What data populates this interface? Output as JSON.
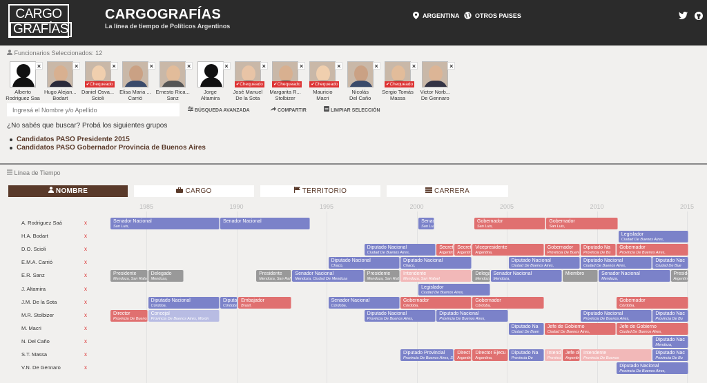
{
  "header": {
    "logo_line1": "CARGO",
    "logo_line2": "GRAFÍAS",
    "title": "CARGOGRAFÍAS",
    "subtitle": "La línea de tiempo de Políticos Argentinos",
    "nav": [
      {
        "label": "ARGENTINA",
        "icon": "map-pin-icon"
      },
      {
        "label": "OTROS PAISES",
        "icon": "globe-icon"
      }
    ],
    "social": [
      {
        "icon": "twitter-icon"
      },
      {
        "icon": "github-icon"
      }
    ]
  },
  "selection": {
    "heading": "Funcionarios Seleccionados: 12",
    "check_label": "Chequeado",
    "people": [
      {
        "name1": "Alberto",
        "name2": "Rodriguez Saa",
        "photo": "silhouette",
        "checked": false
      },
      {
        "name1": "Hugo Alejan...",
        "name2": "Bodart",
        "photo": "photo",
        "checked": false
      },
      {
        "name1": "Daniel Osva...",
        "name2": "Scioli",
        "photo": "photo",
        "checked": true
      },
      {
        "name1": "Elisa Maria ...",
        "name2": "Carrió",
        "photo": "photo",
        "checked": false
      },
      {
        "name1": "Ernesto Rica...",
        "name2": "Sanz",
        "photo": "photo",
        "checked": false
      },
      {
        "name1": "Jorge",
        "name2": "Altamira",
        "photo": "silhouette",
        "checked": false
      },
      {
        "name1": "José Manuel",
        "name2": "De la Sota",
        "photo": "photo",
        "checked": true
      },
      {
        "name1": "Margarita R...",
        "name2": "Stolbizer",
        "photo": "photo",
        "checked": true
      },
      {
        "name1": "Mauricio",
        "name2": "Macri",
        "photo": "photo",
        "checked": true
      },
      {
        "name1": "Nicolás",
        "name2": "Del Caño",
        "photo": "photo",
        "checked": false
      },
      {
        "name1": "Sergio Tomás",
        "name2": "Massa",
        "photo": "photo",
        "checked": true
      },
      {
        "name1": "Victor Norb...",
        "name2": "De Gennaro",
        "photo": "photo",
        "checked": false
      }
    ],
    "search_placeholder": "Ingresá el Nombre y/o Apellido",
    "actions": [
      {
        "label": "BÚSQUEDA AVANZADA",
        "icon": "sliders-icon"
      },
      {
        "label": "COMPARTIR",
        "icon": "share-icon"
      },
      {
        "label": "LIMPIAR SELECCIÓN",
        "icon": "minus-icon"
      }
    ],
    "hint": "¿No sabés que buscar? Probá los siguientes grupos",
    "groups": [
      "Candidatos PASO Presidente 2015",
      "Candidatos PASO Gobernador Provincia de Buenos Aires"
    ]
  },
  "timeline": {
    "heading": "Línea de Tiempo",
    "tabs": [
      {
        "label": "NOMBRE",
        "icon": "user-icon",
        "active": true
      },
      {
        "label": "CARGO",
        "icon": "briefcase-icon",
        "active": false
      },
      {
        "label": "TERRITORIO",
        "icon": "flag-icon",
        "active": false
      },
      {
        "label": "CARRERA",
        "icon": "list-icon",
        "active": false
      }
    ],
    "years": [
      "1985",
      "1990",
      "1995",
      "2000",
      "2005",
      "2010",
      "2015"
    ],
    "remove_mark": "x",
    "colors": {
      "blue": "#7b82c9",
      "red": "#e07070",
      "gray": "#999999",
      "pink": "#f2b8b8",
      "lavender": "#b8bce3"
    },
    "rows": [
      {
        "label": "A. Rodriguez Saá",
        "bars": [
          {
            "t": "Senador Nacional",
            "s": "San Luis,",
            "from": 1983.0,
            "to": 1989.1,
            "c": "blue"
          },
          {
            "t": "Senador Nacional",
            "s": "",
            "from": 1989.1,
            "to": 1994.1,
            "c": "blue"
          },
          {
            "t": "Senad",
            "s": "San Luis,",
            "from": 2000.1,
            "to": 2001.0,
            "c": "blue"
          },
          {
            "t": "Gobernador",
            "s": "San Luis,",
            "from": 2003.2,
            "to": 2007.2,
            "c": "red"
          },
          {
            "t": "Gobernador",
            "s": "San Luis,",
            "from": 2007.2,
            "to": 2011.2,
            "c": "red"
          }
        ]
      },
      {
        "label": "H.A. Bodart",
        "bars": [
          {
            "t": "Legislador",
            "s": "Ciudad De Buenos Aires,",
            "from": 2011.2,
            "to": 2015.1,
            "c": "blue"
          }
        ]
      },
      {
        "label": "D.O. Scioli",
        "bars": [
          {
            "t": "Diputado Nacional",
            "s": "Ciudad De Buenos Aires,",
            "from": 1997.1,
            "to": 2001.1,
            "c": "blue"
          },
          {
            "t": "Secret",
            "s": "Argentin",
            "from": 2001.1,
            "to": 2002.1,
            "c": "red"
          },
          {
            "t": "Secret",
            "s": "Argentin",
            "from": 2002.1,
            "to": 2003.1,
            "c": "red"
          },
          {
            "t": "Vicepresidente",
            "s": "Argentina,",
            "from": 2003.1,
            "to": 2007.1,
            "c": "red"
          },
          {
            "t": "Gobernador",
            "s": "Provincia De Buenos Aires,",
            "from": 2007.1,
            "to": 2009.1,
            "c": "red"
          },
          {
            "t": "Diputado Na",
            "s": "Provincia De Bu",
            "from": 2009.1,
            "to": 2011.1,
            "c": "red"
          },
          {
            "t": "Gobernador",
            "s": "Provincia De Buenos Aires,",
            "from": 2011.1,
            "to": 2015.1,
            "c": "red"
          }
        ]
      },
      {
        "label": "E.M.A. Carrió",
        "bars": [
          {
            "t": "Diputado Nacional",
            "s": "Chaco,",
            "from": 1995.1,
            "to": 1999.1,
            "c": "blue"
          },
          {
            "t": "Diputado Nacional",
            "s": "Chaco,",
            "from": 1999.1,
            "to": 2003.1,
            "c": "blue"
          },
          {
            "t": "Diputado Nacional",
            "s": "Ciudad De Buenos Aires,",
            "from": 2005.1,
            "to": 2009.1,
            "c": "blue"
          },
          {
            "t": "Diputado Nacional",
            "s": "Ciudad De Buenos Aires,",
            "from": 2009.1,
            "to": 2013.1,
            "c": "blue"
          },
          {
            "t": "Diputado Nac",
            "s": "Ciudad De Bue",
            "from": 2013.1,
            "to": 2015.1,
            "c": "blue"
          }
        ]
      },
      {
        "label": "E.R. Sanz",
        "bars": [
          {
            "t": "Presidente",
            "s": "Mendoza, San Rafael",
            "from": 1983.0,
            "to": 1985.1,
            "c": "gray"
          },
          {
            "t": "Delegado",
            "s": "Mendoza,",
            "from": 1985.1,
            "to": 1987.1,
            "c": "gray"
          },
          {
            "t": "Presidente",
            "s": "Mendoza, San Rafael",
            "from": 1991.1,
            "to": 1993.1,
            "c": "gray"
          },
          {
            "t": "Senador Nacional",
            "s": "Mendoza, Ciudad De Mendoza",
            "from": 1993.1,
            "to": 1997.1,
            "c": "blue"
          },
          {
            "t": "Presidente",
            "s": "Mendoza, San Rafael",
            "from": 1997.1,
            "to": 1999.1,
            "c": "gray"
          },
          {
            "t": "Intendente",
            "s": "Mendoza, San Rafael",
            "from": 1999.1,
            "to": 2003.1,
            "c": "pink"
          },
          {
            "t": "Delega",
            "s": "Mendoza,",
            "from": 2003.1,
            "to": 2004.1,
            "c": "gray"
          },
          {
            "t": "Senador Nacional",
            "s": "Mendoza,",
            "from": 2004.1,
            "to": 2008.1,
            "c": "blue"
          },
          {
            "t": "Miembro",
            "s": "",
            "from": 2008.1,
            "to": 2010.1,
            "c": "gray"
          },
          {
            "t": "Senador Nacional",
            "s": "Mendoza,",
            "from": 2010.1,
            "to": 2014.1,
            "c": "blue"
          },
          {
            "t": "Presidente",
            "s": "Argentina,",
            "from": 2014.1,
            "to": 2015.1,
            "c": "gray"
          }
        ]
      },
      {
        "label": "J. Altamira",
        "bars": [
          {
            "t": "Legislador",
            "s": "Ciudad De Buenos Aires,",
            "from": 2000.1,
            "to": 2004.1,
            "c": "blue"
          }
        ]
      },
      {
        "label": "J.M. De la Sota",
        "bars": [
          {
            "t": "Diputado Nacional",
            "s": "Córdoba,",
            "from": 1985.1,
            "to": 1989.1,
            "c": "blue"
          },
          {
            "t": "Diputa",
            "s": "Córdoba",
            "from": 1989.1,
            "to": 1990.1,
            "c": "blue"
          },
          {
            "t": "Embajador",
            "s": "Brasil,",
            "from": 1990.1,
            "to": 1993.1,
            "c": "red"
          },
          {
            "t": "Senador Nacional",
            "s": "Córdoba,",
            "from": 1995.1,
            "to": 1999.1,
            "c": "blue"
          },
          {
            "t": "Gobernador",
            "s": "Córdoba,",
            "from": 1999.1,
            "to": 2003.1,
            "c": "red"
          },
          {
            "t": "Gobernador",
            "s": "Córdoba,",
            "from": 2003.1,
            "to": 2007.1,
            "c": "red"
          },
          {
            "t": "Gobernador",
            "s": "Córdoba,",
            "from": 2011.1,
            "to": 2015.1,
            "c": "red"
          }
        ]
      },
      {
        "label": "M.R. Stolbizer",
        "bars": [
          {
            "t": "Director",
            "s": "Provincia De Buenos Aires",
            "from": 1983.0,
            "to": 1985.1,
            "c": "red"
          },
          {
            "t": "Concejal",
            "s": "Provincia De Buenos Aires, Morón",
            "from": 1985.1,
            "to": 1989.1,
            "c": "lavender"
          },
          {
            "t": "Diputado Nacional",
            "s": "Provincia De Buenos Aires,",
            "from": 1997.1,
            "to": 2001.1,
            "c": "blue"
          },
          {
            "t": "Diputado Nacional",
            "s": "Provincia De Buenos Aires,",
            "from": 2001.1,
            "to": 2005.1,
            "c": "blue"
          },
          {
            "t": "Diputado Nacional",
            "s": "Provincia De Buenos Aires,",
            "from": 2009.1,
            "to": 2013.1,
            "c": "blue"
          },
          {
            "t": "Diputado Nac",
            "s": "Provincia De Bu",
            "from": 2013.1,
            "to": 2015.1,
            "c": "blue"
          }
        ]
      },
      {
        "label": "M. Macri",
        "bars": [
          {
            "t": "Diputado Na",
            "s": "Ciudad De Buen",
            "from": 2005.1,
            "to": 2007.1,
            "c": "blue"
          },
          {
            "t": "Jefe de Gobierno",
            "s": "Ciudad De Buenos Aires,",
            "from": 2007.1,
            "to": 2011.1,
            "c": "red"
          },
          {
            "t": "Jefe de Gobierno",
            "s": "Ciudad De Buenos Aires,",
            "from": 2011.1,
            "to": 2015.1,
            "c": "red"
          }
        ]
      },
      {
        "label": "N. Del Caño",
        "bars": [
          {
            "t": "Diputado Nac",
            "s": "Mendoza,",
            "from": 2013.1,
            "to": 2015.1,
            "c": "blue"
          }
        ]
      },
      {
        "label": "S.T. Massa",
        "bars": [
          {
            "t": "Diputado Provincial",
            "s": "Provincia De Buenos Aires, S",
            "from": 1999.1,
            "to": 2002.1,
            "c": "blue"
          },
          {
            "t": "Direct",
            "s": "Argentin",
            "from": 2002.1,
            "to": 2003.1,
            "c": "red"
          },
          {
            "t": "Director Ejecu",
            "s": "Argentina,",
            "from": 2003.1,
            "to": 2005.1,
            "c": "red"
          },
          {
            "t": "Diputado Na",
            "s": "Provincia De",
            "from": 2005.1,
            "to": 2007.1,
            "c": "blue"
          },
          {
            "t": "Intend",
            "s": "Provincia",
            "from": 2007.1,
            "to": 2008.1,
            "c": "pink"
          },
          {
            "t": "Jefe de",
            "s": "Argentina,",
            "from": 2008.1,
            "to": 2009.1,
            "c": "red"
          },
          {
            "t": "Intendente",
            "s": "Provincia De Buenos",
            "from": 2009.1,
            "to": 2013.1,
            "c": "pink"
          },
          {
            "t": "Diputado Nac",
            "s": "Provincia De Bu",
            "from": 2013.1,
            "to": 2015.1,
            "c": "blue"
          }
        ]
      },
      {
        "label": "V.N. De Gennaro",
        "bars": [
          {
            "t": "Diputado Nacional",
            "s": "Provincia De Buenos Aires,",
            "from": 2011.1,
            "to": 2015.1,
            "c": "blue"
          }
        ]
      }
    ]
  }
}
